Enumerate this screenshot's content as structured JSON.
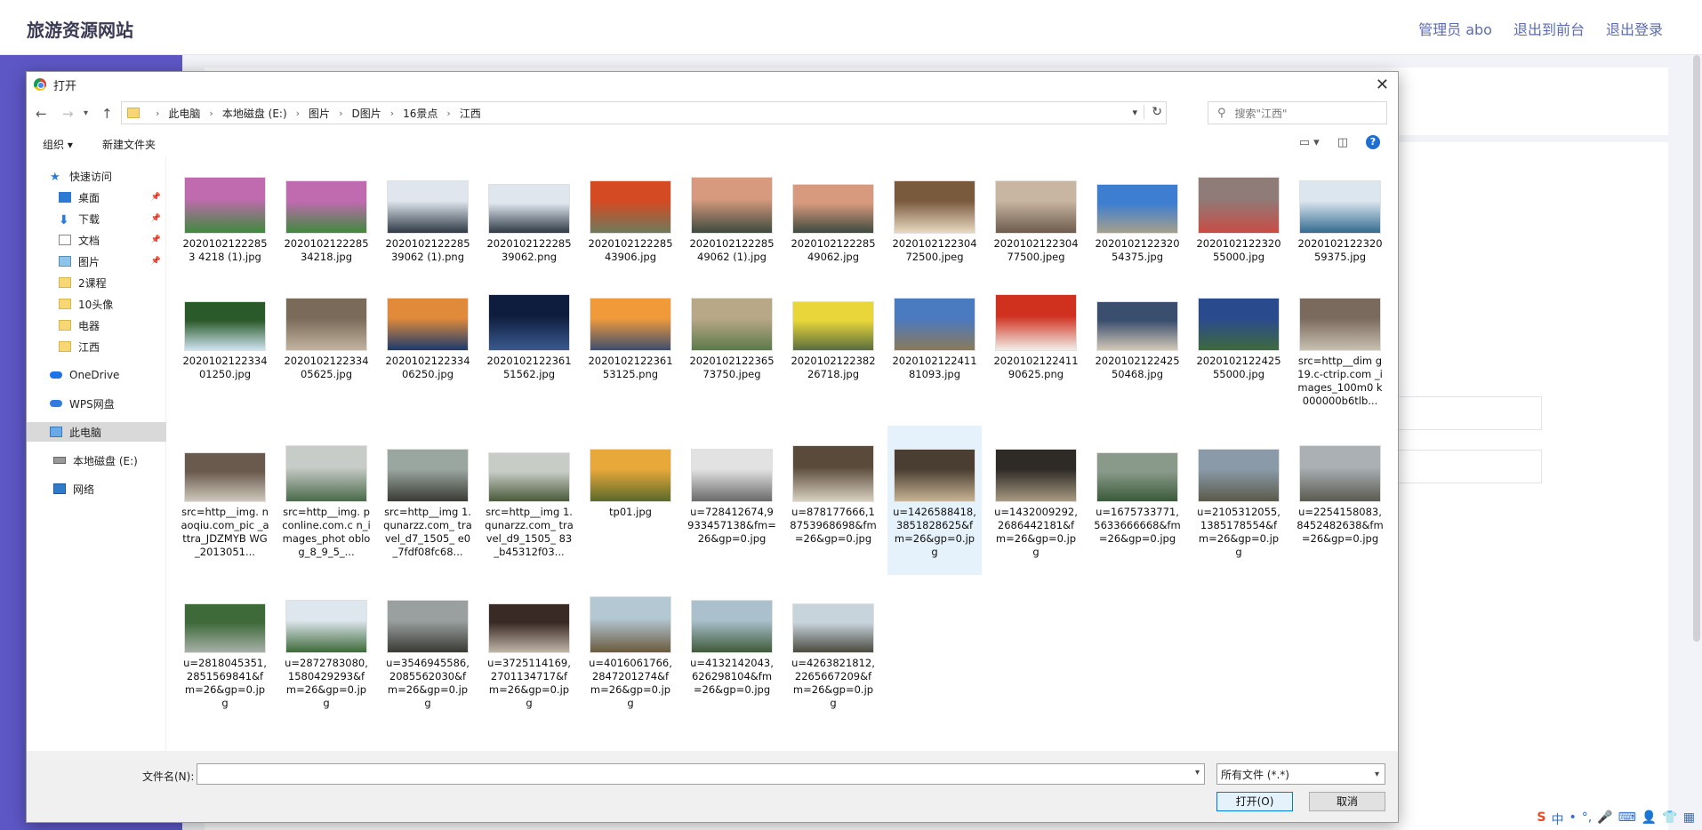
{
  "site": {
    "title": "旅游资源网站",
    "nav": [
      "管理员 abo",
      "退出到前台",
      "退出登录"
    ]
  },
  "dialog": {
    "title": "打开",
    "breadcrumb": [
      "此电脑",
      "本地磁盘 (E:)",
      "图片",
      "D图片",
      "16景点",
      "江西"
    ],
    "search_placeholder": "搜索\"江西\"",
    "toolbar": {
      "organize": "组织 ▾",
      "new_folder": "新建文件夹"
    },
    "nav_items": [
      {
        "label": "快速访问",
        "icon": "star-icon"
      },
      {
        "label": "桌面",
        "icon": "desktop-icon",
        "pinned": true
      },
      {
        "label": "下载",
        "icon": "download-icon",
        "pinned": true
      },
      {
        "label": "文档",
        "icon": "document-icon",
        "pinned": true
      },
      {
        "label": "图片",
        "icon": "pictures-icon",
        "pinned": true
      },
      {
        "label": "2课程",
        "icon": "folder-icon"
      },
      {
        "label": "10头像",
        "icon": "folder-icon"
      },
      {
        "label": "电器",
        "icon": "folder-icon"
      },
      {
        "label": "江西",
        "icon": "folder-icon"
      },
      {
        "label": "OneDrive",
        "icon": "onedrive-icon"
      },
      {
        "label": "WPS网盘",
        "icon": "wps-cloud-icon"
      },
      {
        "label": "此电脑",
        "icon": "this-pc-icon"
      },
      {
        "label": "本地磁盘 (E:)",
        "icon": "disk-icon"
      },
      {
        "label": "网络",
        "icon": "network-icon"
      }
    ],
    "files": [
      {
        "name": "20201021222853 4218 (1).jpg",
        "colors": [
          "#c06ab0",
          "#3f8a3d"
        ]
      },
      {
        "name": "2020102122285 34218.jpg",
        "colors": [
          "#c06ab0",
          "#3f8a3d"
        ]
      },
      {
        "name": "2020102122285 39062 (1).png",
        "colors": [
          "#dfe6ee",
          "#2f3a46"
        ]
      },
      {
        "name": "2020102122285 39062.png",
        "colors": [
          "#dfe6ee",
          "#2f3a46"
        ]
      },
      {
        "name": "2020102122285 43906.jpg",
        "colors": [
          "#d44a23",
          "#6e7a5c"
        ]
      },
      {
        "name": "2020102122285 49062 (1).jpg",
        "colors": [
          "#d89a7e",
          "#3e4a3f"
        ]
      },
      {
        "name": "2020102122285 49062.jpg",
        "colors": [
          "#d89a7e",
          "#3e4a3f"
        ]
      },
      {
        "name": "2020102122304 72500.jpeg",
        "colors": [
          "#7a5a3d",
          "#e9d9c3"
        ]
      },
      {
        "name": "2020102122304 77500.jpeg",
        "colors": [
          "#c8b6a2",
          "#6d5b4c"
        ]
      },
      {
        "name": "2020102122320 54375.jpg",
        "colors": [
          "#3d7ed0",
          "#a5a08c"
        ]
      },
      {
        "name": "2020102122320 55000.jpg",
        "colors": [
          "#8f7b77",
          "#c94c45"
        ]
      },
      {
        "name": "2020102122320 59375.jpg",
        "colors": [
          "#dbe6ef",
          "#346b8f"
        ]
      },
      {
        "name": "2020102122334 01250.jpg",
        "colors": [
          "#2a5a2a",
          "#cfe3f0"
        ]
      },
      {
        "name": "2020102122334 05625.jpg",
        "colors": [
          "#7a6a5a",
          "#c2b4a0"
        ]
      },
      {
        "name": "2020102122334 06250.jpg",
        "colors": [
          "#e08a3a",
          "#1b3a6e"
        ]
      },
      {
        "name": "2020102122361 51562.jpg",
        "colors": [
          "#0e1d3e",
          "#3a5a8e"
        ]
      },
      {
        "name": "2020102122361 53125.png",
        "colors": [
          "#f09a3a",
          "#3e4e6e"
        ]
      },
      {
        "name": "2020102122365 73750.jpeg",
        "colors": [
          "#b9a888",
          "#5b7a4a"
        ]
      },
      {
        "name": "2020102122382 26718.jpg",
        "colors": [
          "#e8d63a",
          "#5a6e3e"
        ]
      },
      {
        "name": "2020102122411 81093.jpg",
        "colors": [
          "#4a7ac0",
          "#8a7a5a"
        ]
      },
      {
        "name": "2020102122411 90625.png",
        "colors": [
          "#d0301e",
          "#f2eee8"
        ]
      },
      {
        "name": "2020102122425 50468.jpg",
        "colors": [
          "#3a4e6e",
          "#d2c8b8"
        ]
      },
      {
        "name": "2020102122425 55000.jpg",
        "colors": [
          "#2a4a8e",
          "#3e6a3e"
        ]
      },
      {
        "name": "src=http__dim g19.c-ctrip.com _images_100m0 k000000b6tlb...",
        "colors": [
          "#7a6a5e",
          "#c8c0b0"
        ]
      },
      {
        "name": "src=http__img. naoqiu.com_pic _attra_JDZMYB WG_2013051...",
        "colors": [
          "#6a5a4e",
          "#cfc8bc"
        ]
      },
      {
        "name": "src=http__img. pconline.com.c n_images_phot oblog_8_9_5_...",
        "colors": [
          "#c8ccc8",
          "#4a6a4a"
        ]
      },
      {
        "name": "src=http__img 1.qunarzz.com_ travel_d7_1505_ e0_7fdf08fc68...",
        "colors": [
          "#9aa6a0",
          "#3a3a34"
        ]
      },
      {
        "name": "src=http__img 1.qunarzz.com_ travel_d9_1505_ 83_b45312f03...",
        "colors": [
          "#c8ccc6",
          "#4a5a3a"
        ]
      },
      {
        "name": "tp01.jpg",
        "colors": [
          "#e8a83a",
          "#5a6a2a"
        ]
      },
      {
        "name": "u=728412674,9 933457138&fm= 26&gp=0.jpg",
        "colors": [
          "#e2e2e2",
          "#6a6a6a"
        ]
      },
      {
        "name": "u=878177666,1 8753968698&fm =26&gp=0.jpg",
        "colors": [
          "#5a4a3a",
          "#d8d0c0"
        ]
      },
      {
        "name": "u=1426588418, 3851828625&f m=26&gp=0.jp g",
        "colors": [
          "#4a3e32",
          "#c8b494"
        ]
      },
      {
        "name": "u=1432009292, 2686442181&f m=26&gp=0.jp g",
        "colors": [
          "#2e2a26",
          "#a89a82"
        ]
      },
      {
        "name": "u=1675733771, 5633666668&fm =26&gp=0.jpg",
        "colors": [
          "#8a9a8a",
          "#3a5a3a"
        ]
      },
      {
        "name": "u=2105312055, 1385178554&f m=26&gp=0.jp g",
        "colors": [
          "#8a9aa8",
          "#5a5a4a"
        ]
      },
      {
        "name": "u=2254158083, 8452482638&fm =26&gp=0.jpg",
        "colors": [
          "#aab0b4",
          "#5a5a50"
        ]
      },
      {
        "name": "u=2818045351, 2851569841&f m=26&gp=0.jp g",
        "colors": [
          "#3e6a3a",
          "#a8b0a8"
        ]
      },
      {
        "name": "u=2872783080, 1580429293&f m=26&gp=0.jp g",
        "colors": [
          "#dee6ee",
          "#3e6a3a"
        ]
      },
      {
        "name": "u=3546945586, 2085562030&f m=26&gp=0.jp g",
        "colors": [
          "#9aa0a0",
          "#3a3a34"
        ]
      },
      {
        "name": "u=3725114169, 2701134717&f m=26&gp=0.jp g",
        "colors": [
          "#3a2a26",
          "#c0b6a8"
        ]
      },
      {
        "name": "u=4016061766, 2847201274&f m=26&gp=0.jp g",
        "colors": [
          "#b4c8d4",
          "#6a5a3e"
        ]
      },
      {
        "name": "u=4132142043, 626298104&fm =26&gp=0.jpg",
        "colors": [
          "#aac0cc",
          "#3e5a3a"
        ]
      },
      {
        "name": "u=4263821812, 2265667209&f m=26&gp=0.jp g",
        "colors": [
          "#c8d4dc",
          "#4a4a3e"
        ]
      }
    ],
    "selected_index": 31,
    "footer": {
      "filename_label": "文件名(N):",
      "filename_value": "",
      "filetype": "所有文件 (*.*)",
      "open": "打开(O)",
      "cancel": "取消"
    }
  },
  "ime": [
    "中",
    "•",
    "°,",
    "🎤",
    "⌨",
    "👤",
    "👕",
    "▦"
  ]
}
